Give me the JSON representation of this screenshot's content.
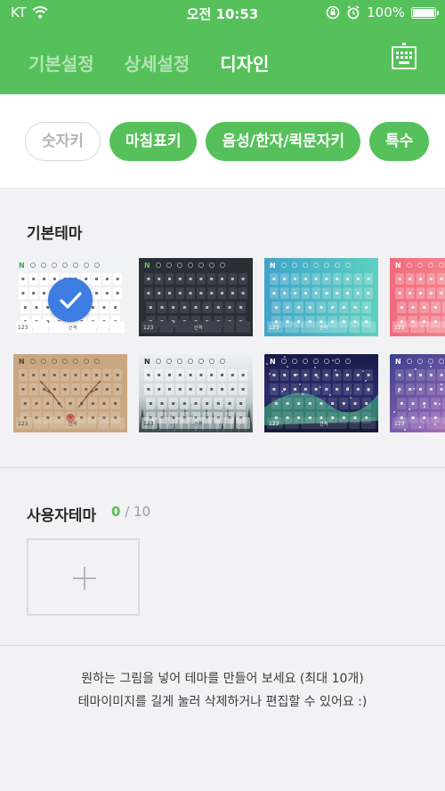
{
  "status_bar": {
    "carrier": "KT",
    "time": "오전 10:53",
    "battery": "100%",
    "battery_level": 1.0
  },
  "header": {
    "tabs": [
      {
        "label": "기본설정",
        "active": false
      },
      {
        "label": "상세설정",
        "active": false
      },
      {
        "label": "디자인",
        "active": true
      }
    ],
    "keyboard_button_icon": "keyboard-icon",
    "bg_color": "#56c15a"
  },
  "chips": [
    {
      "label": "숫자키",
      "selected": false
    },
    {
      "label": "마침표키",
      "selected": true
    },
    {
      "label": "음성/한자/퀵문자키",
      "selected": true
    },
    {
      "label": "특수",
      "selected": true
    }
  ],
  "basic_theme": {
    "title": "기본테마",
    "selected_icon": "check-icon",
    "space_label": "간격",
    "num_key_label": "123",
    "logo_letter": "N",
    "themes": [
      {
        "name": "white",
        "selected": true
      },
      {
        "name": "dark",
        "selected": false
      },
      {
        "name": "teal-gradient",
        "selected": false
      },
      {
        "name": "pink",
        "selected": false
      },
      {
        "name": "reindeer",
        "selected": false
      },
      {
        "name": "snowy-forest",
        "selected": false
      },
      {
        "name": "aurora",
        "selected": false
      },
      {
        "name": "galaxy",
        "selected": false
      }
    ]
  },
  "user_theme": {
    "title": "사용자테마",
    "count": "0",
    "separator": "/",
    "max": "10",
    "add_icon": "plus-icon"
  },
  "info": {
    "line1": "원하는 그림을 넣어 테마를 만들어 보세요 (최대 10개)",
    "line2": "테마이미지를 길게 눌러 삭제하거나 편집할 수 있어요 :)"
  }
}
